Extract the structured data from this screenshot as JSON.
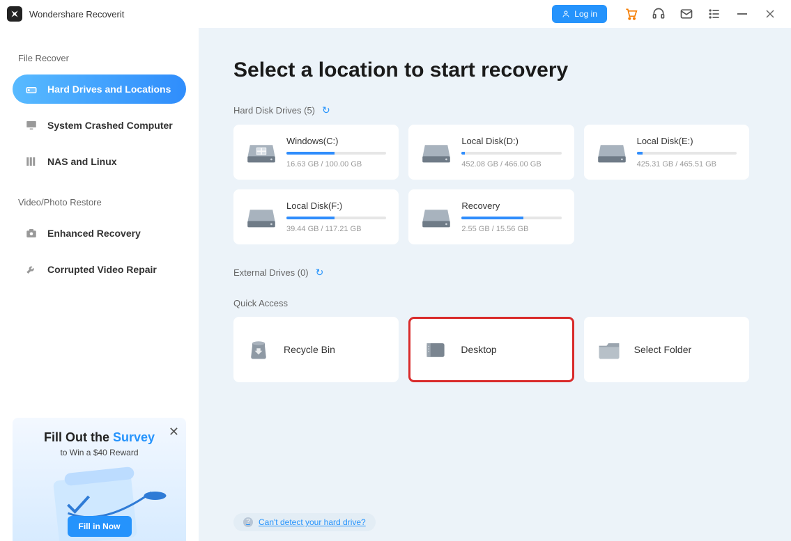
{
  "app": {
    "name": "Wondershare Recoverit"
  },
  "titlebar": {
    "login": "Log in"
  },
  "sidebar": {
    "section1": "File Recover",
    "section2": "Video/Photo Restore",
    "nav": [
      {
        "label": "Hard Drives and Locations"
      },
      {
        "label": "System Crashed Computer"
      },
      {
        "label": "NAS and Linux"
      },
      {
        "label": "Enhanced Recovery"
      },
      {
        "label": "Corrupted Video Repair"
      }
    ],
    "survey": {
      "title_a": "Fill Out the ",
      "title_b": "Survey",
      "subtitle": "to Win a $40 Reward",
      "button": "Fill in Now"
    }
  },
  "main": {
    "title": "Select a location to start recovery",
    "hdd_title": "Hard Disk Drives (5)",
    "ext_title": "External Drives (0)",
    "qa_title": "Quick Access",
    "help": "Can't detect your hard drive?",
    "drives": [
      {
        "name": "Windows(C:)",
        "stats": "16.63 GB / 100.00 GB",
        "pct": 48,
        "os": true
      },
      {
        "name": "Local Disk(D:)",
        "stats": "452.08 GB / 466.00 GB",
        "pct": 3
      },
      {
        "name": "Local Disk(E:)",
        "stats": "425.31 GB / 465.51 GB",
        "pct": 6
      },
      {
        "name": "Local Disk(F:)",
        "stats": "39.44 GB / 117.21 GB",
        "pct": 48
      },
      {
        "name": "Recovery",
        "stats": "2.55 GB / 15.56 GB",
        "pct": 62
      }
    ],
    "quick": [
      {
        "name": "Recycle Bin"
      },
      {
        "name": "Desktop"
      },
      {
        "name": "Select Folder"
      }
    ]
  }
}
